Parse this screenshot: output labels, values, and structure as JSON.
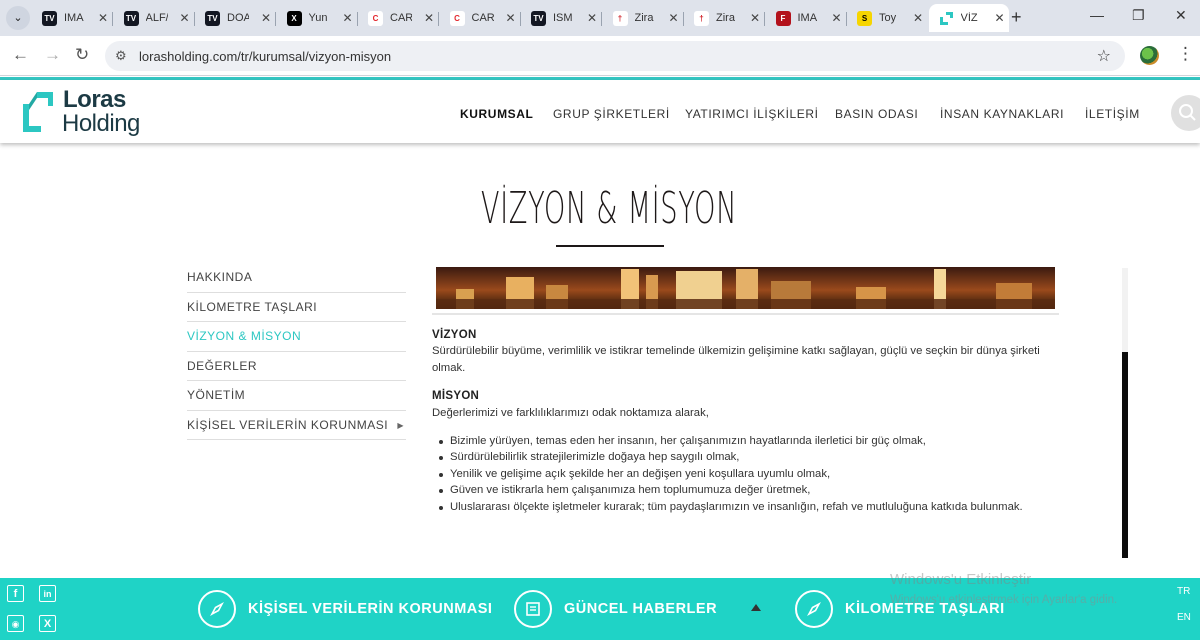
{
  "browser": {
    "tabs": [
      {
        "label": "IMA",
        "favicon_text": "TV",
        "favicon_bg": "#131722",
        "favicon_fg": "#ffffff"
      },
      {
        "label": "ALF/",
        "favicon_text": "TV",
        "favicon_bg": "#131722",
        "favicon_fg": "#ffffff"
      },
      {
        "label": "DOA",
        "favicon_text": "TV",
        "favicon_bg": "#131722",
        "favicon_fg": "#ffffff"
      },
      {
        "label": "Yun",
        "favicon_text": "X",
        "favicon_bg": "#000000",
        "favicon_fg": "#ffffff"
      },
      {
        "label": "CAR",
        "favicon_text": "C",
        "favicon_bg": "#ffffff",
        "favicon_fg": "#e3262d"
      },
      {
        "label": "CAR",
        "favicon_text": "C",
        "favicon_bg": "#ffffff",
        "favicon_fg": "#e3262d"
      },
      {
        "label": "ISM",
        "favicon_text": "TV",
        "favicon_bg": "#131722",
        "favicon_fg": "#ffffff"
      },
      {
        "label": "Zira",
        "favicon_text": "†",
        "favicon_bg": "#ffffff",
        "favicon_fg": "#d0232a"
      },
      {
        "label": "Zira",
        "favicon_text": "†",
        "favicon_bg": "#ffffff",
        "favicon_fg": "#d0232a"
      },
      {
        "label": "IMA",
        "favicon_text": "F",
        "favicon_bg": "#b3121c",
        "favicon_fg": "#ffffff"
      },
      {
        "label": "Toy",
        "favicon_text": "S",
        "favicon_bg": "#f6d500",
        "favicon_fg": "#000000"
      },
      {
        "label": "VİZ",
        "favicon_text": "",
        "favicon_bg": "#ffffff",
        "favicon_fg": "#2cc7c2"
      }
    ],
    "active_tab_index": 11,
    "url": "lorasholding.com/tr/kurumsal/vizyon-misyon"
  },
  "site": {
    "logo": {
      "line1": "Loras",
      "line2": "Holding"
    },
    "nav": [
      "KURUMSAL",
      "GRUP ŞİRKETLERİ",
      "YATIRIMCI İLİŞKİLERİ",
      "BASIN ODASI",
      "İNSAN KAYNAKLARI",
      "İLETİŞİM"
    ],
    "nav_active": "KURUMSAL",
    "accent_color": "#2cc7c2",
    "footer_color": "#1fd3c6"
  },
  "page": {
    "title": "VİZYON & MİSYON",
    "sidebar": [
      {
        "label": "HAKKINDA",
        "has_submenu": false
      },
      {
        "label": "KİLOMETRE TAŞLARI",
        "has_submenu": false
      },
      {
        "label": "VİZYON & MİSYON",
        "has_submenu": false,
        "current": true
      },
      {
        "label": "DEĞERLER",
        "has_submenu": false
      },
      {
        "label": "YÖNETİM",
        "has_submenu": false
      },
      {
        "label": "KİŞİSEL VERİLERİN KORUNMASI",
        "has_submenu": true
      }
    ],
    "vision_heading": "VİZYON",
    "vision_text": "Sürdürülebilir büyüme, verimlilik ve istikrar temelinde ülkemizin gelişimine katkı sağlayan, güçlü ve seçkin bir dünya şirketi olmak.",
    "mission_heading": "MİSYON",
    "mission_intro": "Değerlerimizi ve farklılıklarımızı odak noktamıza alarak,",
    "mission_items": [
      "Bizimle yürüyen, temas eden her insanın, her çalışanımızın hayatlarında ilerletici bir güç olmak,",
      "Sürdürülebilirlik stratejilerimizle doğaya hep saygılı olmak,",
      "Yenilik ve gelişime açık şekilde her an değişen yeni koşullara uyumlu olmak,",
      "Güven ve istikrarla hem çalışanımıza hem toplumumuza değer üretmek,",
      "Uluslararası ölçekte işletmeler kurarak; tüm paydaşlarımızın ve insanlığın, refah ve mutluluğuna katkıda bulunmak."
    ]
  },
  "footer": {
    "links": [
      {
        "label": "KİŞİSEL VERİLERİN KORUNMASI",
        "icon": "compass-icon"
      },
      {
        "label": "GÜNCEL HABERLER",
        "icon": "news-icon"
      },
      {
        "label": "KİLOMETRE TAŞLARI",
        "icon": "compass-icon"
      }
    ],
    "lang": [
      "TR",
      "EN"
    ],
    "social": [
      "facebook-icon",
      "linkedin-icon",
      "instagram-icon",
      "x-icon"
    ]
  },
  "os_watermark": {
    "line1": "Windows'u Etkinleştir",
    "line2": "Windows'u etkinleştirmek için Ayarlar'a gidin."
  }
}
